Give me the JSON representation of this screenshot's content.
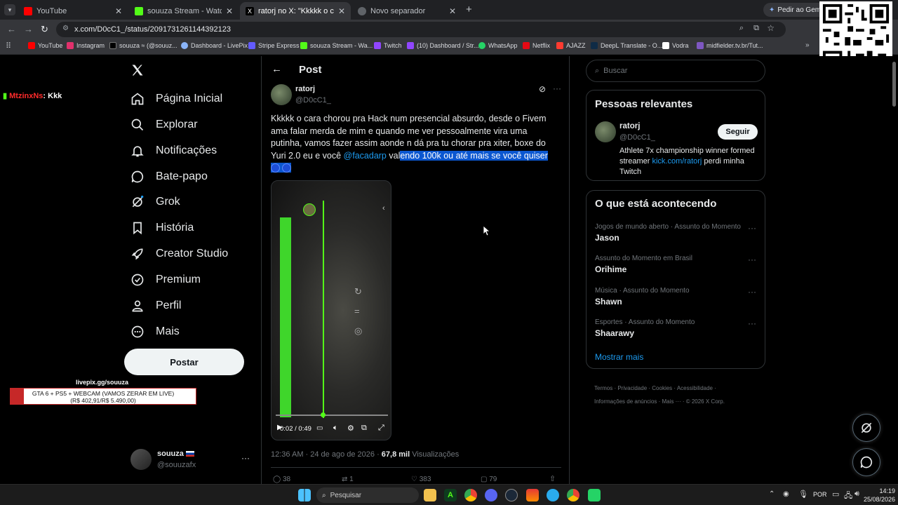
{
  "browser": {
    "tabs": [
      {
        "title": "YouTube",
        "color": "#ff0000"
      },
      {
        "title": "souuza Stream - Watch Live on",
        "color": "#53fc18"
      },
      {
        "title": "ratorj no X: \"Kkkkk o cara chor",
        "color": "#000000"
      },
      {
        "title": "Novo separador",
        "color": "#5f6368"
      }
    ],
    "gemini_label": "Pedir ao Gemini",
    "url": "x.com/D0cC1_/status/2091731261144392123",
    "bookmarks": [
      {
        "label": "YouTube",
        "color": "#ff0000"
      },
      {
        "label": "Instagram",
        "color": "#e1306c"
      },
      {
        "label": "souuza ≈ (@souuz...",
        "color": "#000000"
      },
      {
        "label": "Dashboard - LivePix",
        "color": "#8ab4f8"
      },
      {
        "label": "Stripe Express",
        "color": "#635bff"
      },
      {
        "label": "souuza Stream - Wa...",
        "color": "#53fc18"
      },
      {
        "label": "Twitch",
        "color": "#9146ff"
      },
      {
        "label": "(10) Dashboard / Str...",
        "color": "#9146ff"
      },
      {
        "label": "WhatsApp",
        "color": "#25d366"
      },
      {
        "label": "Netflix",
        "color": "#e50914"
      },
      {
        "label": "AJAZZ",
        "color": "#ff3b30"
      },
      {
        "label": "DeepL Translate - O...",
        "color": "#0f2b46"
      },
      {
        "label": "Vodra",
        "color": "#ffffff"
      },
      {
        "label": "midfielder.tv.br/Tut...",
        "color": "#7e57c2"
      }
    ]
  },
  "overlay": {
    "chat_user": "MtzinxNs",
    "chat_msg": ": Kkk",
    "livepix_url": "livepix.gg/souuza",
    "goal_title": "GTA 6 + PS5 + WEBCAM (VAMOS ZERAR EM LIVE)",
    "goal_amount": "(R$ 402,91/R$ 5.490,00)",
    "goal_progress": 0.0734
  },
  "sidebar": {
    "items": [
      {
        "label": "Página Inicial",
        "icon": "home-icon"
      },
      {
        "label": "Explorar",
        "icon": "search-icon"
      },
      {
        "label": "Notificações",
        "icon": "bell-icon"
      },
      {
        "label": "Bate-papo",
        "icon": "chat-icon"
      },
      {
        "label": "Grok",
        "icon": "grok-icon"
      },
      {
        "label": "História",
        "icon": "bookmark-icon"
      },
      {
        "label": "Creator Studio",
        "icon": "rocket-icon"
      },
      {
        "label": "Premium",
        "icon": "verified-icon"
      },
      {
        "label": "Perfil",
        "icon": "person-icon"
      },
      {
        "label": "Mais",
        "icon": "more-icon"
      }
    ],
    "post_label": "Postar",
    "account_name": "souuza",
    "account_handle": "@souuzafx"
  },
  "post": {
    "header": "Post",
    "author_name": "ratorj",
    "author_handle": "@D0cC1_",
    "text_part1": "Kkkkk o cara chorou pra Hack num presencial absurdo, desde o Fivem ama falar merda de mim e quando me ver pessoalmente vira uma putinha, vamos fazer assim aonde n dá pra tu chorar pra xiter, boxe do Yuri 2.0 eu e você ",
    "mention": "@facadarp",
    "text_part2": " val",
    "text_highlight": "endo 100k ou até mais se você quiser",
    "video_time": "0:02 / 0:49",
    "timestamp": "12:36 AM · 24 de ago de 2026",
    "views_count": "67,8 mil",
    "views_label": "Visualizações",
    "replies": "38",
    "reposts": "1",
    "likes": "383",
    "bookmarks": "79"
  },
  "right": {
    "search_placeholder": "Buscar",
    "relevant_title": "Pessoas relevantes",
    "relevant_name": "ratorj",
    "relevant_handle": "@D0cC1_",
    "follow_label": "Seguir",
    "bio_text": "Athlete 7x championship winner formed streamer ",
    "bio_link": "kick.com/ratorj",
    "bio_tail": " perdi minha Twitch",
    "trends_title": "O que está acontecendo",
    "trends": [
      {
        "context": "Jogos de mundo aberto · Assunto do Momento",
        "name": "Jason"
      },
      {
        "context": "Assunto do Momento em Brasil",
        "name": "Orihime"
      },
      {
        "context": "Música · Assunto do Momento",
        "name": "Shawn"
      },
      {
        "context": "Esportes · Assunto do Momento",
        "name": "Shaarawy"
      }
    ],
    "show_more": "Mostrar mais",
    "footer_line1": [
      "Termos",
      "Privacidade",
      "Cookies",
      "Acessibilidade"
    ],
    "footer_line2": [
      "Informações de anúncios",
      "Mais ···",
      "© 2026 X Corp."
    ]
  },
  "taskbar": {
    "search_label": "Pesquisar",
    "language": "POR",
    "time": "14:19",
    "date": "25/08/2026"
  }
}
